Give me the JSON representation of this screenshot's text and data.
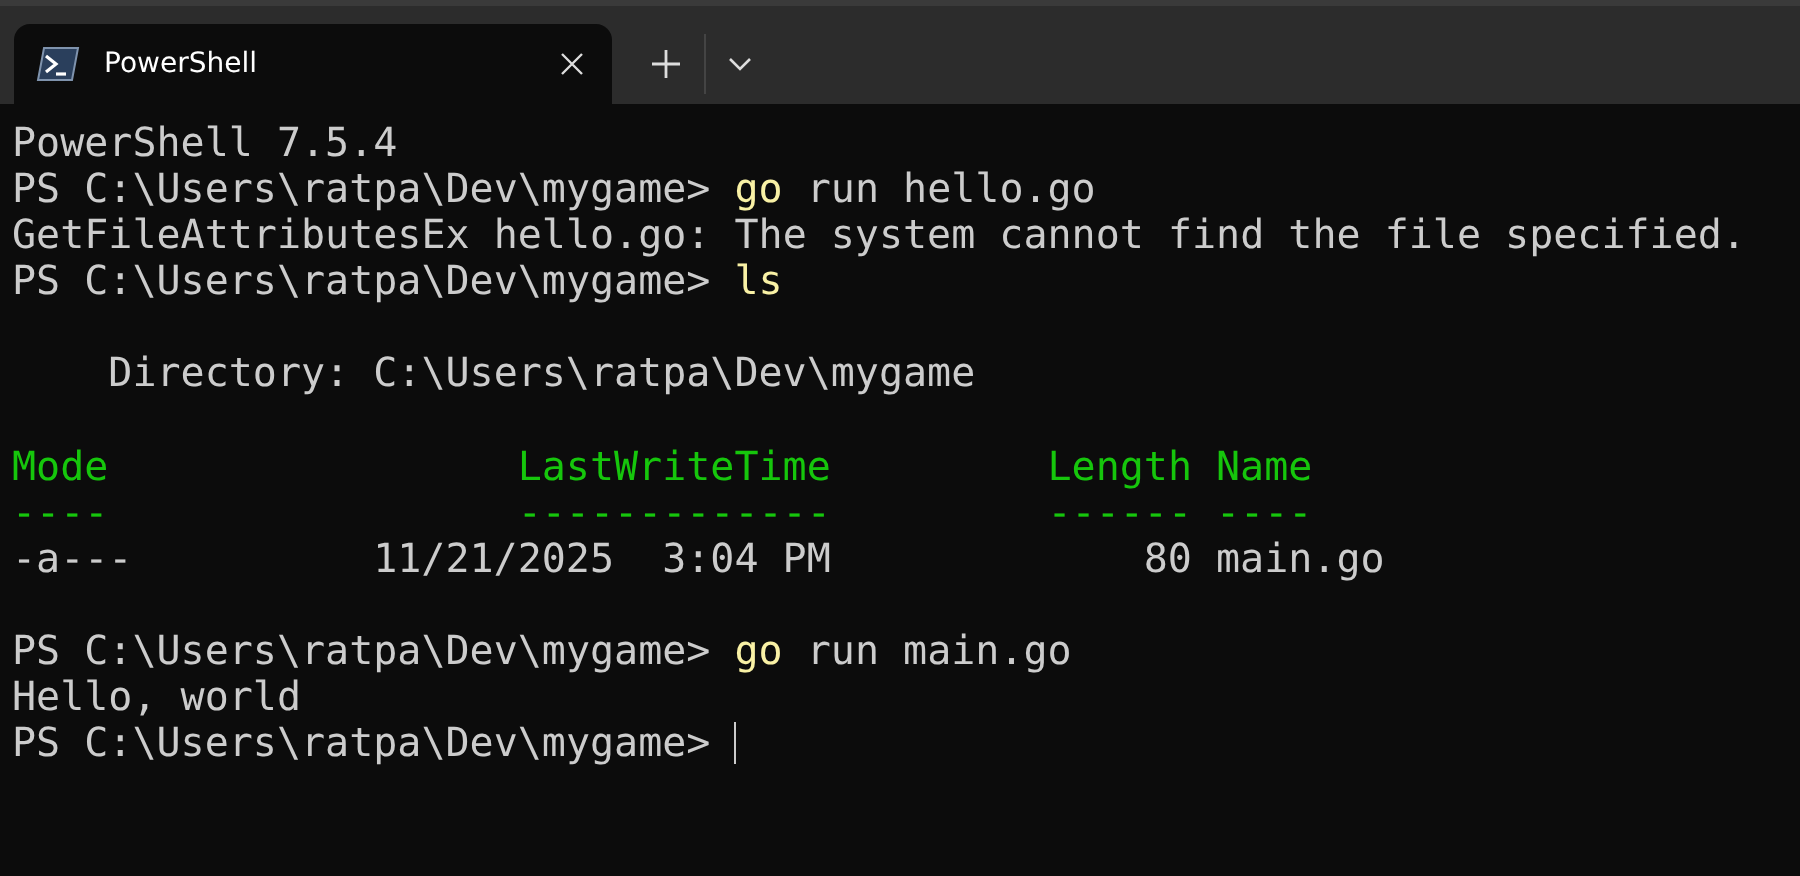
{
  "tabs": [
    {
      "title": "PowerShell",
      "selected": true
    }
  ],
  "terminal": {
    "lines": [
      {
        "kind": "output",
        "text": "PowerShell 7.5.4"
      },
      {
        "kind": "prompt",
        "prompt": "PS C:\\Users\\ratpa\\Dev\\mygame>",
        "command": "go",
        "args": "run hello.go"
      },
      {
        "kind": "output",
        "text": "GetFileAttributesEx hello.go: The system cannot find the file specified."
      },
      {
        "kind": "prompt",
        "prompt": "PS C:\\Users\\ratpa\\Dev\\mygame>",
        "command": "ls"
      },
      {
        "kind": "blank"
      },
      {
        "kind": "indented",
        "text": "Directory: C:\\Users\\ratpa\\Dev\\mygame"
      },
      {
        "kind": "blank"
      },
      {
        "kind": "table",
        "columns": [
          {
            "label": "Mode",
            "underline": "----"
          },
          {
            "label": "LastWriteTime",
            "underline": "-------------"
          },
          {
            "label": "Length",
            "underline": "------"
          },
          {
            "label": "Name",
            "underline": "----"
          }
        ],
        "rows": [
          [
            "-a---",
            "11/21/2025  3:04 PM",
            "80",
            "main.go"
          ]
        ]
      },
      {
        "kind": "blank"
      },
      {
        "kind": "prompt",
        "prompt": "PS C:\\Users\\ratpa\\Dev\\mygame>",
        "command": "go",
        "args": "run main.go"
      },
      {
        "kind": "output",
        "text": "Hello, world"
      },
      {
        "kind": "prompt",
        "prompt": "PS C:\\Users\\ratpa\\Dev\\mygame>",
        "cursor": true
      }
    ]
  }
}
